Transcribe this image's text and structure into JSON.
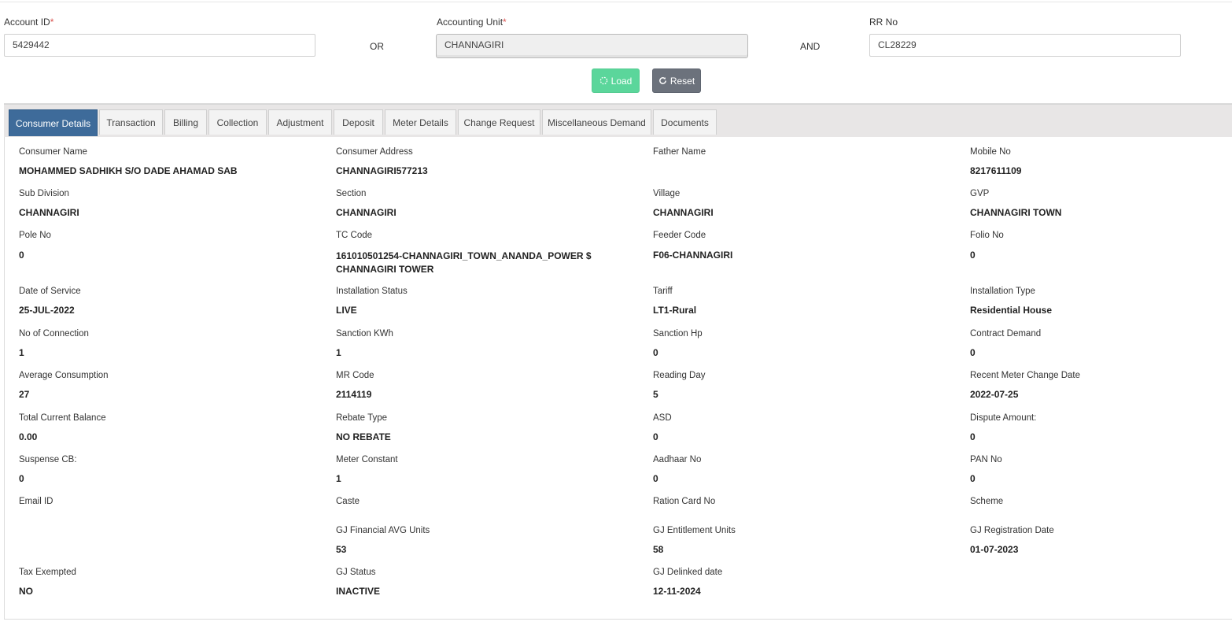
{
  "search": {
    "account_id_label": "Account ID",
    "account_id_value": "5429442",
    "or_label": "OR",
    "accounting_unit_label": "Accounting Unit",
    "accounting_unit_value": "CHANNAGIRI",
    "and_label": "AND",
    "rr_no_label": "RR No",
    "rr_no_value": "CL28229",
    "required_mark": "*",
    "load_label": "Load",
    "reset_label": "Reset"
  },
  "tabs": [
    {
      "label": "Consumer Details"
    },
    {
      "label": "Transaction"
    },
    {
      "label": "Billing"
    },
    {
      "label": "Collection"
    },
    {
      "label": "Adjustment"
    },
    {
      "label": "Deposit"
    },
    {
      "label": "Meter Details"
    },
    {
      "label": "Change Request"
    },
    {
      "label": "Miscellaneous Demand"
    },
    {
      "label": "Documents"
    }
  ],
  "fields": [
    {
      "label": "Consumer Name",
      "value": "MOHAMMED SADHIKH S/O DADE AHAMAD SAB"
    },
    {
      "label": "Consumer Address",
      "value": "CHANNAGIRI577213"
    },
    {
      "label": "Father Name",
      "value": ""
    },
    {
      "label": "Mobile No",
      "value": "8217611109"
    },
    {
      "label": "Sub Division",
      "value": "CHANNAGIRI"
    },
    {
      "label": "Section",
      "value": "CHANNAGIRI"
    },
    {
      "label": "Village",
      "value": "CHANNAGIRI"
    },
    {
      "label": "GVP",
      "value": "CHANNAGIRI TOWN"
    },
    {
      "label": "Pole No",
      "value": "0"
    },
    {
      "label": "TC Code",
      "value": "161010501254-CHANNAGIRI_TOWN_ANANDA_POWER $ CHANNAGIRI TOWER"
    },
    {
      "label": "Feeder Code",
      "value": "F06-CHANNAGIRI"
    },
    {
      "label": "Folio No",
      "value": "0"
    },
    {
      "label": "Date of Service",
      "value": "25-JUL-2022"
    },
    {
      "label": "Installation Status",
      "value": "LIVE"
    },
    {
      "label": "Tariff",
      "value": "LT1-Rural"
    },
    {
      "label": "Installation Type",
      "value": "Residential House"
    },
    {
      "label": "No of Connection",
      "value": "1"
    },
    {
      "label": "Sanction KWh",
      "value": "1"
    },
    {
      "label": "Sanction Hp",
      "value": "0"
    },
    {
      "label": "Contract Demand",
      "value": "0"
    },
    {
      "label": "Average Consumption",
      "value": "27"
    },
    {
      "label": "MR Code",
      "value": "2114119"
    },
    {
      "label": "Reading Day",
      "value": "5"
    },
    {
      "label": "Recent Meter Change Date",
      "value": "2022-07-25"
    },
    {
      "label": "Total Current Balance",
      "value": "0.00"
    },
    {
      "label": "Rebate Type",
      "value": "NO REBATE"
    },
    {
      "label": "ASD",
      "value": "0"
    },
    {
      "label": "Dispute Amount:",
      "value": "0"
    },
    {
      "label": "Suspense CB:",
      "value": "0"
    },
    {
      "label": "Meter Constant",
      "value": "1"
    },
    {
      "label": "Aadhaar No",
      "value": "0"
    },
    {
      "label": "PAN No",
      "value": "0"
    },
    {
      "label": "Email ID",
      "value": ""
    },
    {
      "label": "Caste",
      "value": ""
    },
    {
      "label": "Ration Card No",
      "value": ""
    },
    {
      "label": "Scheme",
      "value": ""
    },
    {
      "label": "GJ Financial AVG Units",
      "value": "53"
    },
    {
      "label": "GJ Entitlement Units",
      "value": "58"
    },
    {
      "label": "GJ Registration Date",
      "value": "01-07-2023"
    },
    {
      "label": "Tax Exempted",
      "value": "NO"
    },
    {
      "label": "GJ Status",
      "value": "INACTIVE"
    },
    {
      "label": "GJ Delinked date",
      "value": "12-11-2024"
    }
  ],
  "colors": {
    "active_tab": "#3e6b9a",
    "load_button": "#5bd69b",
    "reset_button": "#6c727c",
    "required": "#d9534f"
  },
  "icons": {
    "load": "spinner-icon",
    "reset": "refresh-icon"
  }
}
